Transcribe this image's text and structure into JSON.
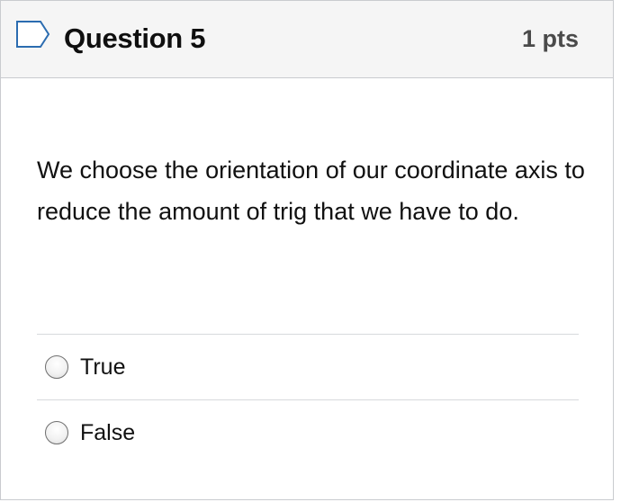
{
  "question": {
    "title": "Question 5",
    "points": "1 pts",
    "flag_icon": "flag-outline-icon",
    "text": "We choose the orientation of our coordinate axis to reduce the amount of trig that we have to do."
  },
  "answers": [
    {
      "label": "True",
      "selected": false
    },
    {
      "label": "False",
      "selected": false
    }
  ],
  "colors": {
    "header_bg": "#f5f5f5",
    "border": "#c9cbcf",
    "flag_stroke": "#2b6cb0",
    "points_text": "#4a4a4a"
  }
}
